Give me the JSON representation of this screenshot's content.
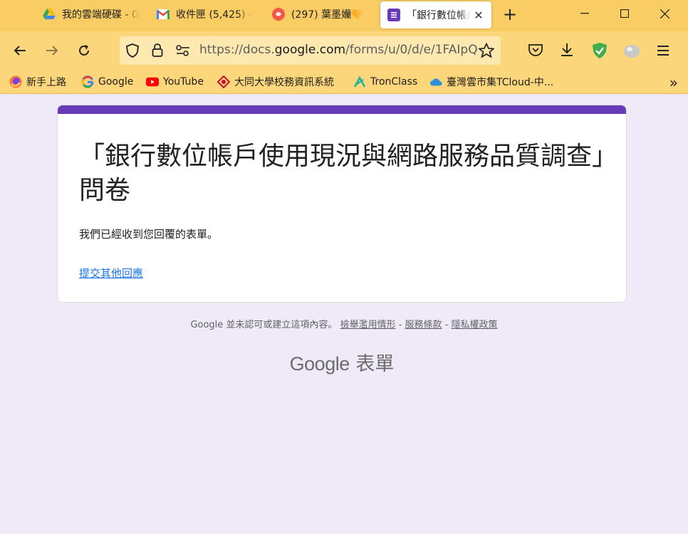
{
  "browser": {
    "tabs": [
      {
        "label": "我的雲端硬碟 - G",
        "icon": "google-drive-icon"
      },
      {
        "label": "收件匣 (5,425) - ",
        "icon": "gmail-icon"
      },
      {
        "label": "(297) 葉墨孏🧡",
        "icon": "app-icon"
      },
      {
        "label": "「銀行數位帳戶",
        "icon": "google-forms-icon",
        "active": true
      }
    ],
    "url_prefix": "https://docs.",
    "url_domain": "google.com",
    "url_rest": "/forms/u/0/d/e/1FAIpQ",
    "bookmarks": [
      {
        "label": "新手上路",
        "icon": "firefox-icon"
      },
      {
        "label": "Google",
        "icon": "google-icon"
      },
      {
        "label": "YouTube",
        "icon": "youtube-icon"
      },
      {
        "label": "大同大學校務資訊系統",
        "icon": "ttu-icon"
      },
      {
        "label": "TronClass",
        "icon": "tronclass-icon"
      },
      {
        "label": "臺灣雲市集TCloud-中...",
        "icon": "tcloud-icon"
      }
    ]
  },
  "form": {
    "title": "「銀行數位帳戶使用現況與網路服務品質調查」問卷",
    "confirmation": "我們已經收到您回覆的表單。",
    "another_response": "提交其他回應"
  },
  "footer": {
    "text": "Google 並未認可或建立這項內容。",
    "link1": "檢舉濫用情形",
    "sep": " - ",
    "link2": "服務條款",
    "link3": "隱私權政策"
  },
  "brand": {
    "google": "Google",
    "product": "表單"
  },
  "colors": {
    "accent": "#673ab7",
    "link": "#1a73e8",
    "toolbar": "#fbd67a",
    "background": "#efe9f8"
  }
}
